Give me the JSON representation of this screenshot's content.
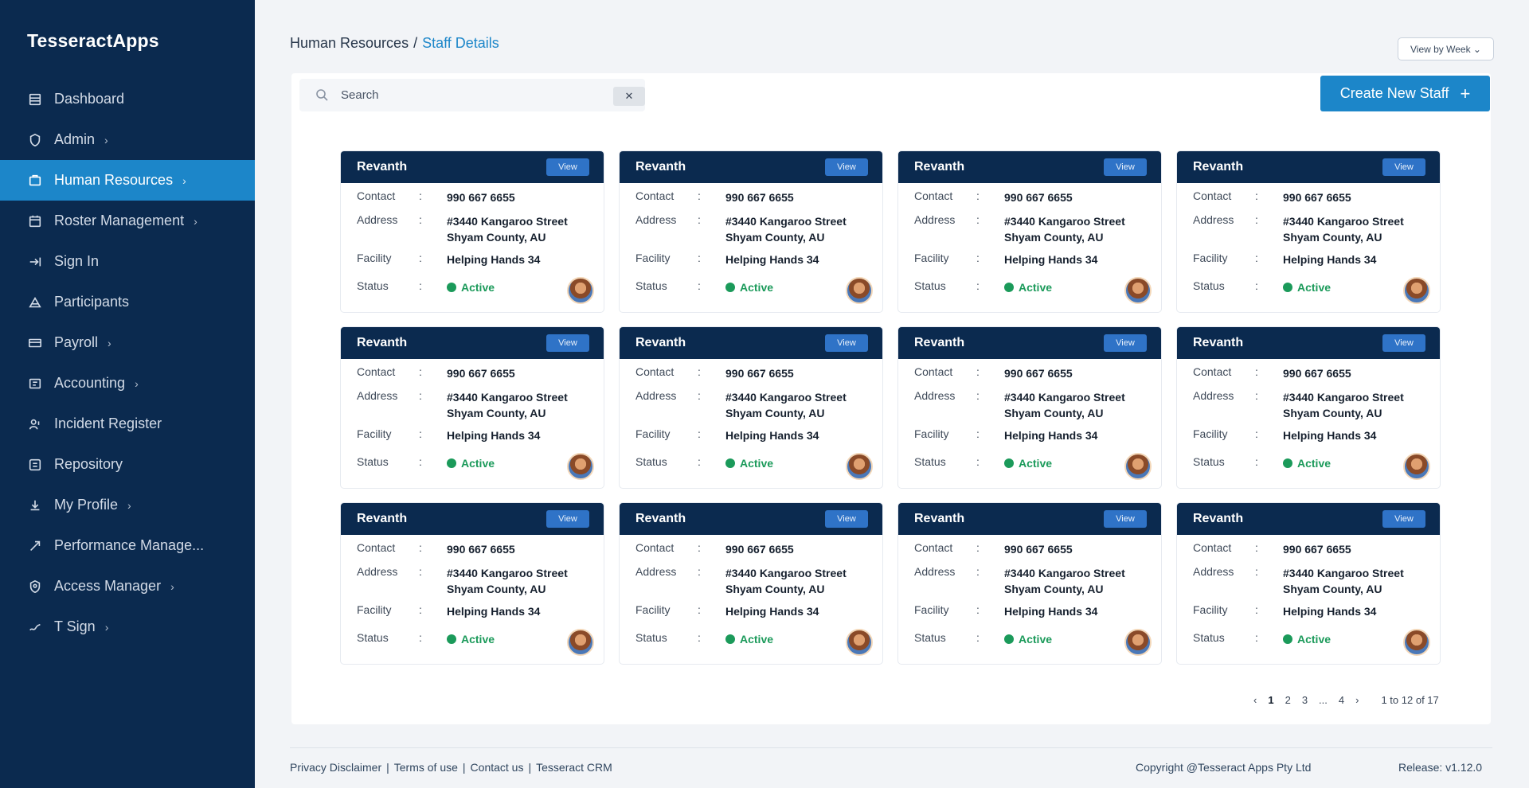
{
  "app": {
    "brand": "TesseractApps"
  },
  "sidebar": {
    "items": [
      {
        "label": "Dashboard",
        "icon": "dashboard-icon",
        "has_chevron": false
      },
      {
        "label": "Admin",
        "icon": "admin-icon",
        "has_chevron": true
      },
      {
        "label": "Human Resources",
        "icon": "human-resources-icon",
        "has_chevron": true,
        "active": true
      },
      {
        "label": "Roster Management",
        "icon": "calendar-icon",
        "has_chevron": true
      },
      {
        "label": "Sign In",
        "icon": "sign-in-icon",
        "has_chevron": false
      },
      {
        "label": "Participants",
        "icon": "participants-icon",
        "has_chevron": false
      },
      {
        "label": "Payroll",
        "icon": "payroll-icon",
        "has_chevron": true
      },
      {
        "label": "Accounting",
        "icon": "accounting-icon",
        "has_chevron": true
      },
      {
        "label": "Incident Register",
        "icon": "incident-icon",
        "has_chevron": false
      },
      {
        "label": "Repository",
        "icon": "repository-icon",
        "has_chevron": false
      },
      {
        "label": "My Profile",
        "icon": "profile-icon",
        "has_chevron": true
      },
      {
        "label": "Performance Manage...",
        "icon": "performance-icon",
        "has_chevron": false
      },
      {
        "label": "Access Manager",
        "icon": "access-icon",
        "has_chevron": true
      },
      {
        "label": "T Sign",
        "icon": "sign-icon",
        "has_chevron": true
      }
    ]
  },
  "header": {
    "breadcrumb_parent": "Human Resources",
    "breadcrumb_sep": "/",
    "breadcrumb_current": "Staff Details",
    "view_select": "View by Week ⌄"
  },
  "toolbar": {
    "search_placeholder": "Search",
    "search_clear": "✕",
    "create_label": "Create New Staff",
    "create_icon": "+"
  },
  "labels": {
    "contact": "Contact",
    "address": "Address",
    "facility": "Facility",
    "status": "Status",
    "colon": ":"
  },
  "staff": [
    {
      "name": "Revanth",
      "view": "View",
      "contact": "990 667 6655",
      "address1": "#3440 Kangaroo Street",
      "address2": "Shyam County, AU",
      "facility": "Helping Hands 34",
      "status": "Active"
    },
    {
      "name": "Revanth",
      "view": "View",
      "contact": "990 667 6655",
      "address1": "#3440 Kangaroo Street",
      "address2": "Shyam County, AU",
      "facility": "Helping Hands 34",
      "status": "Active"
    },
    {
      "name": "Revanth",
      "view": "View",
      "contact": "990 667 6655",
      "address1": "#3440 Kangaroo Street",
      "address2": "Shyam County, AU",
      "facility": "Helping Hands 34",
      "status": "Active"
    },
    {
      "name": "Revanth",
      "view": "View",
      "contact": "990 667 6655",
      "address1": "#3440 Kangaroo Street",
      "address2": "Shyam County, AU",
      "facility": "Helping Hands 34",
      "status": "Active"
    },
    {
      "name": "Revanth",
      "view": "View",
      "contact": "990 667 6655",
      "address1": "#3440 Kangaroo Street",
      "address2": "Shyam County, AU",
      "facility": "Helping Hands 34",
      "status": "Active"
    },
    {
      "name": "Revanth",
      "view": "View",
      "contact": "990 667 6655",
      "address1": "#3440 Kangaroo Street",
      "address2": "Shyam County, AU",
      "facility": "Helping Hands 34",
      "status": "Active"
    },
    {
      "name": "Revanth",
      "view": "View",
      "contact": "990 667 6655",
      "address1": "#3440 Kangaroo Street",
      "address2": "Shyam County, AU",
      "facility": "Helping Hands 34",
      "status": "Active"
    },
    {
      "name": "Revanth",
      "view": "View",
      "contact": "990 667 6655",
      "address1": "#3440 Kangaroo Street",
      "address2": "Shyam County, AU",
      "facility": "Helping Hands 34",
      "status": "Active"
    },
    {
      "name": "Revanth",
      "view": "View",
      "contact": "990 667 6655",
      "address1": "#3440 Kangaroo Street",
      "address2": "Shyam County, AU",
      "facility": "Helping Hands 34",
      "status": "Active"
    },
    {
      "name": "Revanth",
      "view": "View",
      "contact": "990 667 6655",
      "address1": "#3440 Kangaroo Street",
      "address2": "Shyam County, AU",
      "facility": "Helping Hands 34",
      "status": "Active"
    },
    {
      "name": "Revanth",
      "view": "View",
      "contact": "990 667 6655",
      "address1": "#3440 Kangaroo Street",
      "address2": "Shyam County, AU",
      "facility": "Helping Hands 34",
      "status": "Active"
    },
    {
      "name": "Revanth",
      "view": "View",
      "contact": "990 667 6655",
      "address1": "#3440 Kangaroo Street",
      "address2": "Shyam County, AU",
      "facility": "Helping Hands 34",
      "status": "Active"
    }
  ],
  "pagination": {
    "prev": "‹",
    "pages": [
      "1",
      "2",
      "3",
      "...",
      "4"
    ],
    "next": "›",
    "info": "1 to 12 of 17"
  },
  "footer": {
    "links": [
      "Privacy Disclaimer",
      "|",
      "Terms of use",
      "|",
      "Contact us",
      "|",
      "Tesseract CRM"
    ],
    "copyright": "Copyright @Tesseract Apps Pty Ltd",
    "release": "Release: v1.12.0"
  },
  "colors": {
    "sidebar_bg": "#0b2a4f",
    "accent": "#1c86c9",
    "card_header": "#0b2a4f",
    "status_active": "#1b9a5a"
  }
}
